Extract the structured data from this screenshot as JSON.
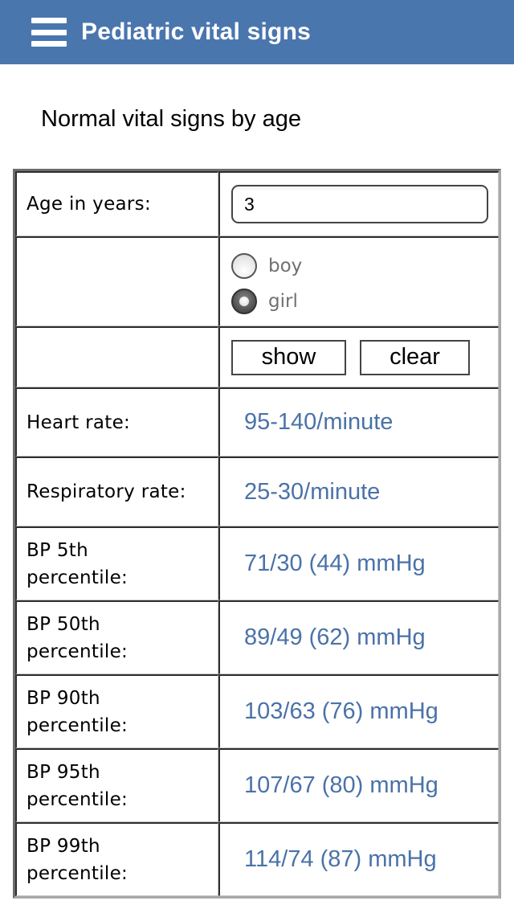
{
  "header": {
    "menu_icon": "hamburger-menu-icon",
    "title": "Pediatric vital signs"
  },
  "page": {
    "subtitle": "Normal vital signs by age"
  },
  "form": {
    "age_label": "Age in years:",
    "age_value": "3",
    "sex_options": [
      {
        "label": "boy",
        "checked": false
      },
      {
        "label": "girl",
        "checked": true
      }
    ],
    "show_label": "show",
    "clear_label": "clear"
  },
  "results": {
    "heart_rate": {
      "label": "Heart rate:",
      "value": "95-140/minute"
    },
    "respiratory_rate": {
      "label": "Respiratory rate:",
      "value": "25-30/minute"
    },
    "bp": [
      {
        "label_line1": "BP 5th",
        "label_line2": "percentile:",
        "value": "71/30 (44) mmHg"
      },
      {
        "label_line1": "BP 50th",
        "label_line2": "percentile:",
        "value": "89/49 (62) mmHg"
      },
      {
        "label_line1": "BP 90th",
        "label_line2": "percentile:",
        "value": "103/63 (76) mmHg"
      },
      {
        "label_line1": "BP 95th",
        "label_line2": "percentile:",
        "value": "107/67 (80) mmHg"
      },
      {
        "label_line1": "BP 99th",
        "label_line2": "percentile:",
        "value": "114/74 (87) mmHg"
      }
    ]
  },
  "colors": {
    "header_bg": "#4a76ae",
    "value_text": "#4a72a8"
  }
}
